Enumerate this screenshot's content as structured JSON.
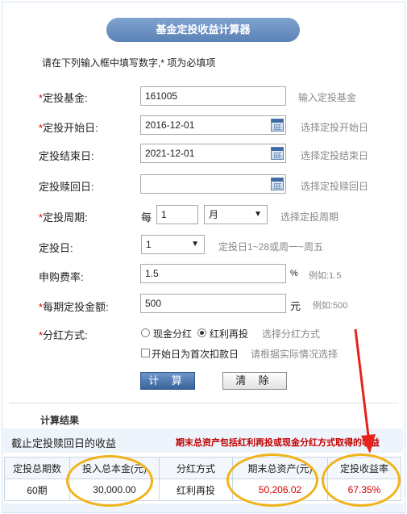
{
  "title": "基金定投收益计算器",
  "intro": "请在下列输入框中填写数字,* 项为必填项",
  "form": {
    "fund": {
      "required": true,
      "label": "定投基金:",
      "value": "161005",
      "hint": "输入定投基金"
    },
    "start_date": {
      "required": true,
      "label": "定投开始日:",
      "value": "2016-12-01",
      "hint": "选择定投开始日"
    },
    "end_date": {
      "required": false,
      "label": "定投结束日:",
      "value": "2021-12-01",
      "hint": "选择定投结束日"
    },
    "redeem_date": {
      "required": false,
      "label": "定投赎回日:",
      "value": "",
      "hint": "选择定投赎回日"
    },
    "period": {
      "required": true,
      "label": "定投周期:",
      "prefix": "每",
      "count": "1",
      "unit": "月",
      "hint": "选择定投周期"
    },
    "day": {
      "required": false,
      "label": "定投日:",
      "value": "1",
      "hint": "定投日1~28或周一~周五"
    },
    "fee": {
      "required": false,
      "label": "申购费率:",
      "value": "1.5",
      "unit": "%",
      "hint": "例如:1.5"
    },
    "amount": {
      "required": true,
      "label": "每期定投金额:",
      "value": "500",
      "unit": "元",
      "hint": "例如:500"
    },
    "dividend": {
      "required": true,
      "label": "分红方式:",
      "options": [
        "现金分红",
        "红利再投"
      ],
      "selected": "红利再投",
      "hint": "选择分红方式",
      "checkbox_label": "开始日为首次扣款日",
      "checkbox_hint": "请根据实际情况选择"
    }
  },
  "buttons": {
    "calc": "计 算",
    "clear": "清 除"
  },
  "results": {
    "section_title": "计算结果",
    "summary": "截止定投赎回日的收益",
    "note": "期末总资产包括红利再投或现金分红方式取得的收益",
    "headers": [
      "定投总期数",
      "投入总本金(元)",
      "分红方式",
      "期末总资产(元)",
      "定投收益率"
    ],
    "row": [
      "60期",
      "30,000.00",
      "红利再投",
      "50,206.02",
      "67.35%"
    ]
  },
  "colors": {
    "annotation": "#f0b31a",
    "arrow": "#e8211a",
    "accent_red": "#d40000",
    "pill": "#5b82b6"
  }
}
